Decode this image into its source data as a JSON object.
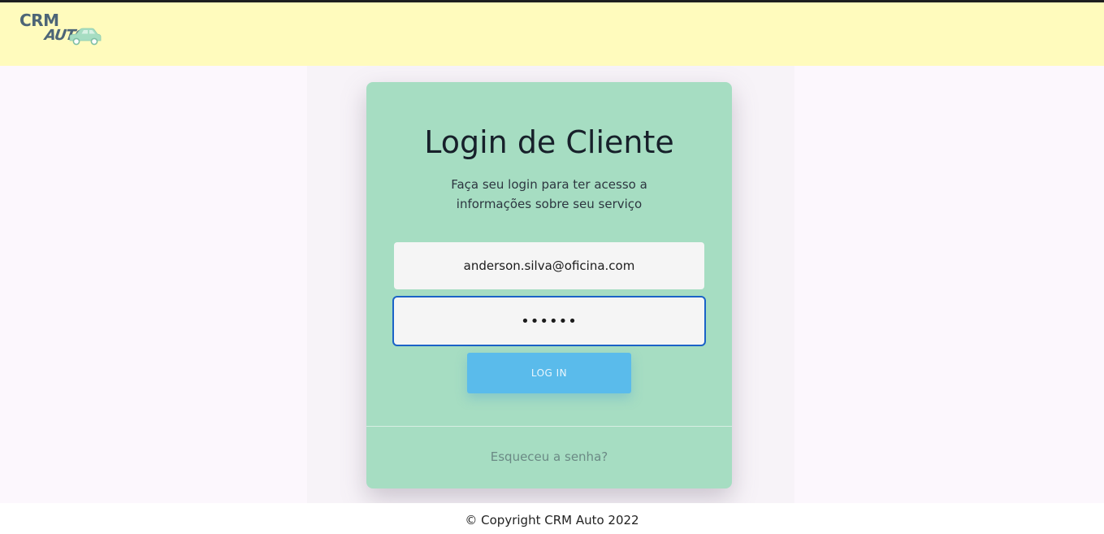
{
  "header": {
    "logo": {
      "line1": "CRM",
      "line2": "AUTO",
      "icon": "car-icon"
    }
  },
  "login_card": {
    "title": "Login de Cliente",
    "subtitle": "Faça seu login para ter acesso a informações sobre seu serviço",
    "email_value": "anderson.silva@oficina.com",
    "password_value": "••••••",
    "login_button_label": "LOG IN",
    "forgot_link_label": "Esqueceu a senha?"
  },
  "footer": {
    "copyright": "© Copyright CRM Auto 2022"
  },
  "colors": {
    "header_bg": "#fffbbd",
    "card_bg": "#a6ddc2",
    "button_bg": "#5abbeb",
    "focus_border": "#1b63c7",
    "logo_text": "#4d6577",
    "logo_car": "#a6ddc2"
  }
}
